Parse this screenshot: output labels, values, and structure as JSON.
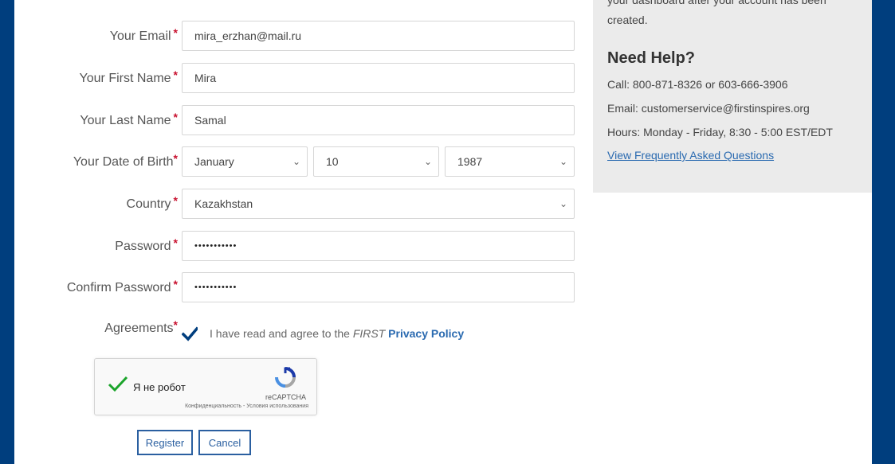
{
  "form": {
    "email": {
      "label": "Your Email",
      "value": "mira_erzhan@mail.ru"
    },
    "first_name": {
      "label": "Your First Name",
      "value": "Mira"
    },
    "last_name": {
      "label": "Your Last Name",
      "value": "Samal"
    },
    "dob": {
      "label": "Your Date of Birth",
      "month": "January",
      "day": "10",
      "year": "1987"
    },
    "country": {
      "label": "Country",
      "value": "Kazakhstan"
    },
    "password": {
      "label": "Password",
      "value": "•••••••••••"
    },
    "confirm_password": {
      "label": "Confirm Password",
      "value": "•••••••••••"
    },
    "required_mark": "*",
    "agreements": {
      "label": "Agreements",
      "text_prefix": "I have read and agree to the ",
      "text_first": "FIRST",
      "link": "Privacy Policy",
      "checked": true
    },
    "captcha": {
      "text": "Я не робот",
      "brand": "reCAPTCHA",
      "terms": "Конфиденциальность - Условия использования"
    },
    "buttons": {
      "register": "Register",
      "cancel": "Cancel"
    }
  },
  "help": {
    "cut_text": "your dashboard after your account has been",
    "created": "created.",
    "title": "Need Help?",
    "call": "Call: 800-871-8326 or 603-666-3906",
    "email": "Email: customerservice@firstinspires.org",
    "hours": "Hours: Monday - Friday, 8:30 - 5:00 EST/EDT",
    "faq_link": "View Frequently Asked Questions"
  },
  "colors": {
    "navy": "#003e7e",
    "required": "#c8102e",
    "link": "#2a6ab0",
    "help_bg": "#ebebeb",
    "captcha_check": "#1ba42b"
  },
  "icons": {
    "select_arrow": "chevron-down-icon",
    "checkbox": "checkmark-icon",
    "captcha_check": "green-checkmark-icon",
    "captcha_logo": "recaptcha-logo-icon"
  }
}
